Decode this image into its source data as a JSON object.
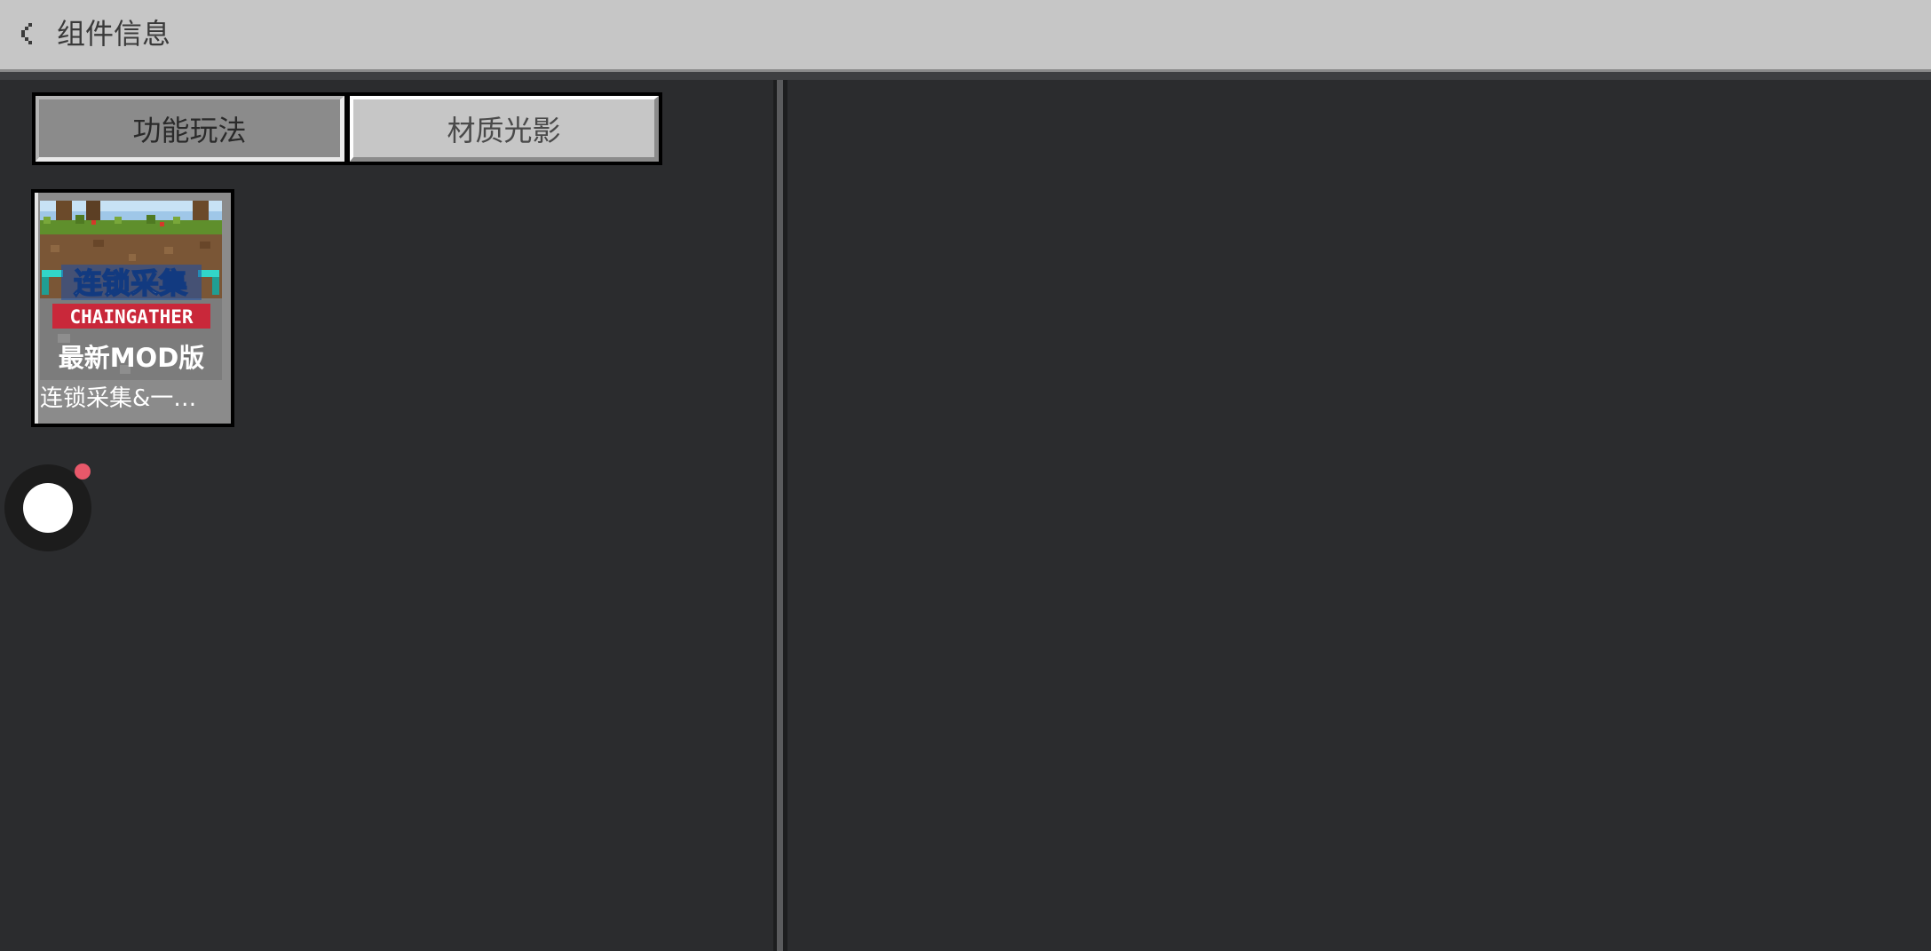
{
  "header": {
    "title": "组件信息",
    "back_icon": "chevron-left-icon"
  },
  "tabs": [
    {
      "label": "功能玩法",
      "active": true
    },
    {
      "label": "材质光影",
      "active": false
    }
  ],
  "addons": [
    {
      "name": "连锁采集&一…",
      "thumbnail": {
        "title_cn": "连锁采集",
        "title_en": "CHAINGATHER",
        "subtitle": "最新MOD版"
      }
    }
  ],
  "floating_button": {
    "icon": "assistive-touch-icon",
    "has_notification": true
  },
  "colors": {
    "background": "#2b2c2e",
    "header": "#c6c6c6",
    "notification": "#e8586a",
    "title_cn": "#ffffff",
    "title_en_bg": "#c9283a"
  }
}
